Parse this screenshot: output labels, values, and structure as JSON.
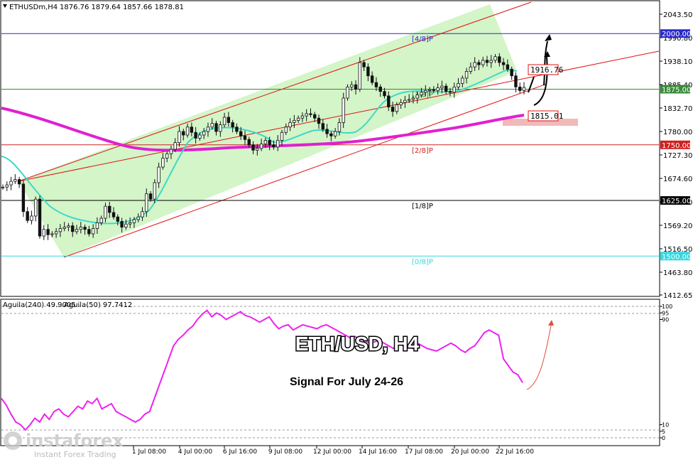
{
  "header": {
    "symbol": "ETHUSDm,H4",
    "ohlc": "1876.76 1879.64 1857.66 1878.81"
  },
  "overlay": {
    "title": "ETH/USD, H4",
    "subtitle": "Signal For July 24-26"
  },
  "indicator_header": {
    "text1": "Aguila(240) 49.9005",
    "text2": "Aguila(50) 97.7412"
  },
  "brand": {
    "name": "instaforex",
    "tagline": "Instant Forex Trading"
  },
  "colors": {
    "background": "#ffffff",
    "channel_fill": "#d3f5c8",
    "channel_line": "#e01010",
    "ma_long": "#e020d0",
    "ma_short": "#40d8c8",
    "candle": "#111111",
    "murray_4_8": "#2a2acc",
    "murray_3_8": "#3a8a3a",
    "murray_2_8": "#d02020",
    "murray_1_8": "#000000",
    "murray_0_8": "#30d8e0",
    "oscillator": "#ee22ee",
    "arrow_down_curve": "#e05040"
  },
  "chart_data": {
    "type": "candlestick",
    "symbol": "ETHUSDm",
    "timeframe": "H4",
    "y_axis_ticks": [
      2043.5,
      1990.8,
      1938.1,
      1885.4,
      1832.7,
      1780.0,
      1727.3,
      1674.6,
      1621.9,
      1569.2,
      1516.5,
      1463.8,
      1412.65
    ],
    "y_axis_tick_labels": [
      "2043.50",
      "1990.80",
      "1938.10",
      "1885.40",
      "1832.70",
      "1780.00",
      "1727.30",
      "1674.60",
      "1621.90",
      "1569.20",
      "1516.50",
      "1463.80",
      "1412.65"
    ],
    "x_axis_ticks": [
      "1 Jul 08:00",
      "4 Jul 00:00",
      "6 Jul 16:00",
      "9 Jul 08:00",
      "12 Jul 00:00",
      "14 Jul 16:00",
      "17 Jul 08:00",
      "20 Jul 00:00",
      "22 Jul 16:00"
    ],
    "murray_levels": [
      {
        "label": "[4/8]P",
        "value": 2000.0,
        "tag": "2000.00",
        "color": "#2a2acc"
      },
      {
        "label": "[3/8]P",
        "value": 1875.0,
        "tag": "1875.00",
        "color": "#3a8a3a"
      },
      {
        "label": "[2/8]P",
        "value": 1750.0,
        "tag": "1750.00",
        "color": "#d02020"
      },
      {
        "label": "[1/8]P",
        "value": 1625.0,
        "tag": "1625.00",
        "color": "#000000"
      },
      {
        "label": "[0/8]P",
        "value": 1500.0,
        "tag": "1500.00",
        "color": "#30d8e0"
      }
    ],
    "annotations": [
      {
        "text": "1916.76",
        "value": 1916.76
      },
      {
        "text": "1815.01",
        "value": 1815.01
      }
    ],
    "candles_close": [
      1655,
      1660,
      1668,
      1672,
      1662,
      1600,
      1580,
      1590,
      1628,
      1545,
      1560,
      1548,
      1550,
      1555,
      1562,
      1565,
      1568,
      1555,
      1560,
      1565,
      1560,
      1550,
      1562,
      1575,
      1585,
      1612,
      1598,
      1588,
      1578,
      1565,
      1572,
      1575,
      1582,
      1588,
      1600,
      1640,
      1628,
      1665,
      1700,
      1720,
      1730,
      1740,
      1755,
      1780,
      1772,
      1790,
      1778,
      1765,
      1772,
      1780,
      1790,
      1798,
      1780,
      1795,
      1812,
      1800,
      1790,
      1780,
      1770,
      1762,
      1750,
      1738,
      1742,
      1752,
      1760,
      1750,
      1745,
      1760,
      1778,
      1790,
      1800,
      1805,
      1810,
      1815,
      1820,
      1818,
      1810,
      1798,
      1785,
      1775,
      1770,
      1780,
      1800,
      1855,
      1880,
      1885,
      1875,
      1935,
      1925,
      1905,
      1890,
      1880,
      1870,
      1860,
      1835,
      1825,
      1840,
      1845,
      1850,
      1852,
      1855,
      1862,
      1868,
      1872,
      1874,
      1872,
      1878,
      1882,
      1870,
      1868,
      1880,
      1888,
      1900,
      1915,
      1925,
      1935,
      1930,
      1940,
      1935,
      1940,
      1948,
      1935,
      1930,
      1920,
      1905,
      1880,
      1872,
      1879
    ],
    "series": [
      {
        "name": "Aguila(240)",
        "value": 49.9005
      },
      {
        "name": "Aguila(50)",
        "value": 97.7412
      }
    ],
    "oscillator_ticks": [
      100,
      95,
      90,
      10,
      5,
      0
    ],
    "oscillator_values": [
      30,
      25,
      18,
      12,
      10,
      6,
      10,
      15,
      12,
      18,
      14,
      20,
      22,
      18,
      16,
      20,
      24,
      22,
      28,
      26,
      30,
      22,
      24,
      26,
      20,
      18,
      16,
      14,
      12,
      14,
      18,
      20,
      30,
      40,
      50,
      60,
      70,
      75,
      78,
      82,
      85,
      90,
      94,
      97,
      92,
      95,
      93,
      90,
      92,
      94,
      96,
      93,
      92,
      90,
      88,
      90,
      92,
      87,
      83,
      85,
      86,
      82,
      84,
      86,
      85,
      84,
      83,
      85,
      86,
      84,
      82,
      80,
      78,
      76,
      77,
      75,
      74,
      72,
      73,
      74,
      72,
      70,
      68,
      72,
      70,
      70,
      68,
      72,
      70,
      68,
      67,
      66,
      68,
      70,
      72,
      70,
      67,
      65,
      68,
      70,
      75,
      80,
      82,
      80,
      78,
      60,
      55,
      50,
      48,
      42
    ]
  }
}
